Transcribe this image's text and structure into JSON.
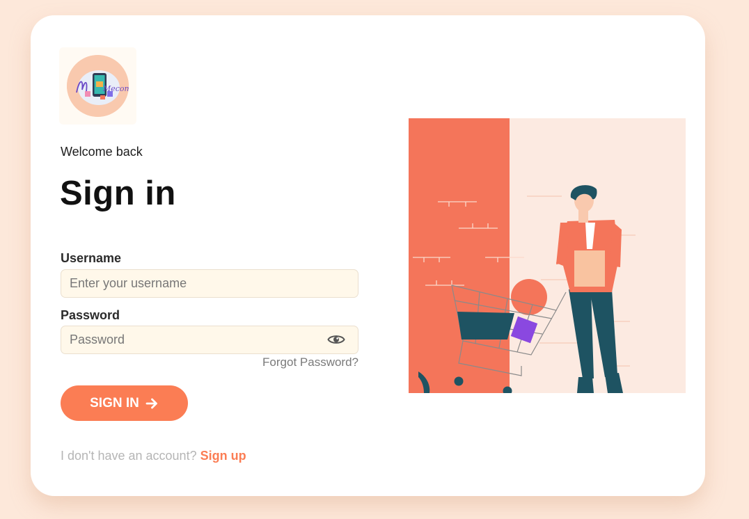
{
  "brand": {
    "logo_icon": "mecom-logo-icon",
    "logo_text": "Mecom"
  },
  "form": {
    "welcome": "Welcome back",
    "title": "Sign in",
    "username_label": "Username",
    "username_placeholder": "Enter your username",
    "username_value": "",
    "password_label": "Password",
    "password_placeholder": "Password",
    "password_value": "",
    "show_password_icon": "eye-icon",
    "forgot_password": "Forgot Password?",
    "submit_label": "SIGN IN",
    "submit_icon": "arrow-right-icon",
    "no_account_text": "I don't have an account?",
    "signup_link": "Sign up"
  },
  "illustration": {
    "subject": "man-with-shopping-cart-illustration"
  },
  "colors": {
    "background": "#fde8da",
    "accent": "#fb7d54",
    "input_bg": "#fff8ea",
    "illustration_red": "#f4755a",
    "illustration_teal": "#1e5362"
  }
}
